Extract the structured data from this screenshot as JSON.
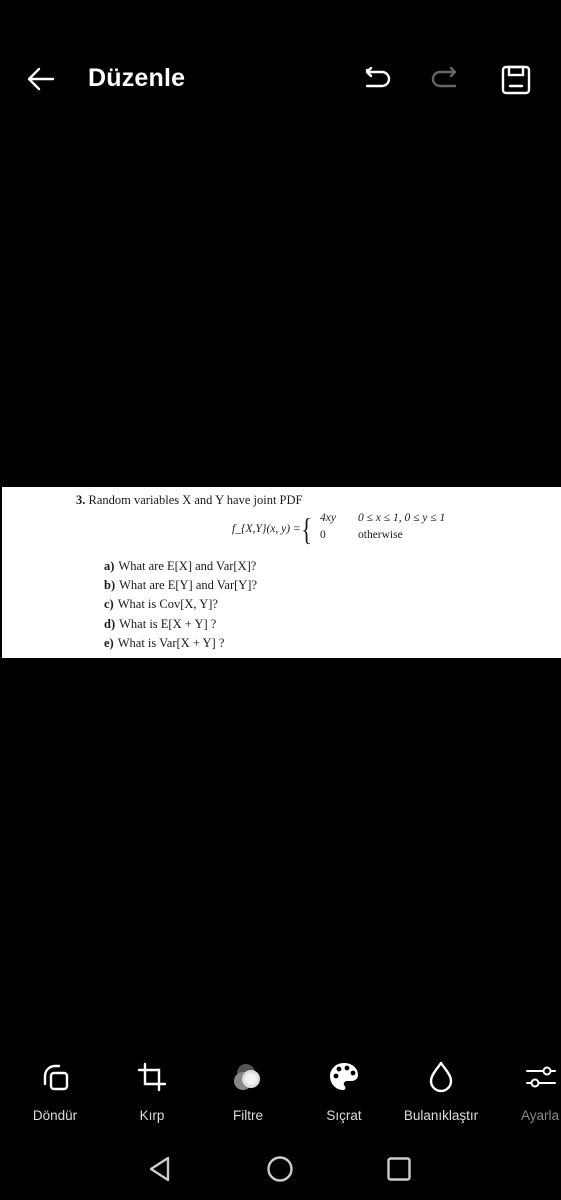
{
  "header": {
    "title": "Düzenle",
    "back_icon": "arrow-left-icon",
    "undo_icon": "undo-icon",
    "redo_icon": "redo-icon",
    "save_icon": "save-icon",
    "redo_enabled": false
  },
  "photo": {
    "problem_number": "3.",
    "intro": "Random variables X and Y have joint PDF",
    "formula": {
      "lhs": "f_{X,Y}(x, y) =",
      "case1_value": "4xy",
      "case1_condition": "0 ≤ x ≤ 1, 0 ≤ y ≤ 1",
      "case2_value": "0",
      "case2_condition": "otherwise"
    },
    "questions": [
      {
        "label": "a)",
        "text": "What are E[X] and Var[X]?"
      },
      {
        "label": "b)",
        "text": "What are E[Y] and Var[Y]?"
      },
      {
        "label": "c)",
        "text": "What is Cov[X, Y]?"
      },
      {
        "label": "d)",
        "text": "What is E[X + Y] ?"
      },
      {
        "label": "e)",
        "text": "What is Var[X + Y] ?"
      }
    ]
  },
  "toolbar": {
    "tools": [
      {
        "label": "Döndür",
        "icon": "rotate-icon"
      },
      {
        "label": "Kırp",
        "icon": "crop-icon"
      },
      {
        "label": "Filtre",
        "icon": "filter-icon"
      },
      {
        "label": "Sıçrat",
        "icon": "palette-icon"
      },
      {
        "label": "Bulanıklaştır",
        "icon": "blur-drop-icon"
      },
      {
        "label": "Ayarla",
        "icon": "adjust-sliders-icon"
      }
    ]
  },
  "navbar": {
    "back": "nav-back-icon",
    "home": "nav-home-icon",
    "recents": "nav-recents-icon"
  }
}
